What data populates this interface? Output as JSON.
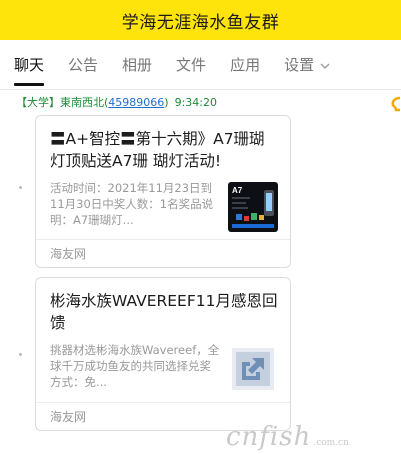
{
  "window": {
    "title": "学海无涯海水鱼友群"
  },
  "tabs": [
    {
      "label": "聊天",
      "active": true
    },
    {
      "label": "公告"
    },
    {
      "label": "相册"
    },
    {
      "label": "文件"
    },
    {
      "label": "应用"
    },
    {
      "label": "设置"
    }
  ],
  "message": {
    "sender_tag": "【大学】",
    "sender_name": "東南西北",
    "sender_id": "45989066",
    "time": "9:34:20"
  },
  "cards": [
    {
      "title": "〓A+智控〓第十六期》A7珊瑚灯顶贴送A7珊 瑚灯活动!",
      "desc": "活动时间：2021年11月23日到11月30日中奖人数：1名奖品说明：A7珊瑚灯...",
      "thumb_icon": "a7-coral-lamp-thumbnail",
      "thumb_text": "A7",
      "source": "海友网"
    },
    {
      "title": "彬海水族WAVEREEF11月感恩回馈",
      "desc": "挑器材选彬海水族Wavereef，全球千万成功鱼友的共同选择兑奖方式：免...",
      "thumb_icon": "link-share-icon",
      "source": "海友网"
    }
  ],
  "watermark": {
    "text": "cnfish",
    "suffix": ".com.cn"
  },
  "colors": {
    "titlebar_bg": "#ffe40c",
    "sender": "#1b8b36",
    "link": "#1f6fd1"
  }
}
